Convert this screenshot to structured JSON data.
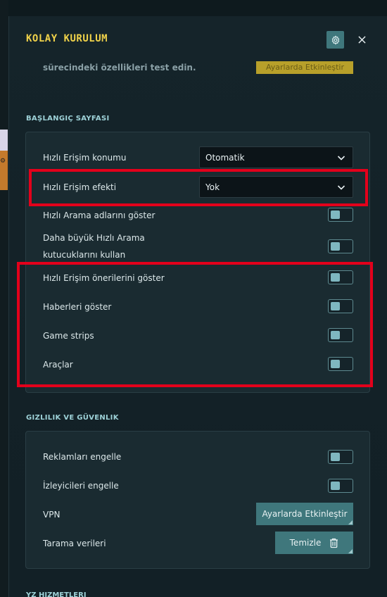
{
  "dialog": {
    "title": "KOLAY KURULUM",
    "intro_text": "sürecindeki özellikleri test edin.",
    "intro_button": "Ayarlarda Etkinleştir"
  },
  "start_page": {
    "section_title": "BAŞLANGIÇ SAYFASI",
    "quick_access_position": {
      "label": "Hızlı Erişim konumu",
      "value": "Otomatik"
    },
    "quick_access_effect": {
      "label": "Hızlı Erişim efekti",
      "value": "Yok"
    },
    "toggles": [
      {
        "label": "Hızlı Arama adlarını göster",
        "on": false
      },
      {
        "label_line1": "Daha büyük Hızlı Arama",
        "label_line2": "kutucuklarını kullan",
        "on": false
      },
      {
        "label": "Hızlı Erişim önerilerini göster",
        "on": false
      },
      {
        "label": "Haberleri göster",
        "on": false
      },
      {
        "label": "Game strips",
        "on": false
      },
      {
        "label": "Araçlar",
        "on": false
      }
    ]
  },
  "privacy": {
    "section_title": "GIZLILIK VE GÜVENLIK",
    "block_ads": {
      "label": "Reklamları engelle",
      "on": false
    },
    "block_trackers": {
      "label": "İzleyicileri engelle",
      "on": false
    },
    "vpn": {
      "label": "VPN",
      "button": "Ayarlarda Etkinleştir"
    },
    "browsing_data": {
      "label": "Tarama verileri",
      "button": "Temizle"
    }
  },
  "next_section_title": "YZ HIZMETLERI",
  "colors": {
    "accent_title": "#f0d24a",
    "section_title": "#9ed2d8",
    "button_bg": "#3f777c",
    "highlight_red": "#e3001b"
  },
  "icons": {
    "settings": "gear-icon",
    "close": "close-icon",
    "dropdown": "chevron-down-icon",
    "trash": "trash-icon"
  }
}
